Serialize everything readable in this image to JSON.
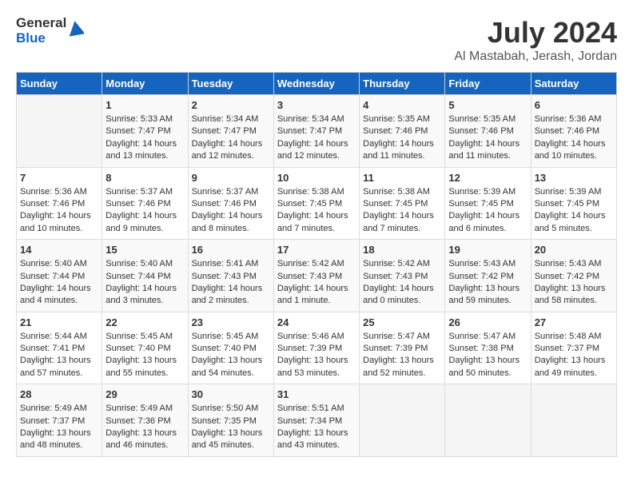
{
  "header": {
    "logo_general": "General",
    "logo_blue": "Blue",
    "month_title": "July 2024",
    "location": "Al Mastabah, Jerash, Jordan"
  },
  "columns": [
    "Sunday",
    "Monday",
    "Tuesday",
    "Wednesday",
    "Thursday",
    "Friday",
    "Saturday"
  ],
  "weeks": [
    [
      {
        "day": "",
        "info": ""
      },
      {
        "day": "1",
        "info": "Sunrise: 5:33 AM\nSunset: 7:47 PM\nDaylight: 14 hours\nand 13 minutes."
      },
      {
        "day": "2",
        "info": "Sunrise: 5:34 AM\nSunset: 7:47 PM\nDaylight: 14 hours\nand 12 minutes."
      },
      {
        "day": "3",
        "info": "Sunrise: 5:34 AM\nSunset: 7:47 PM\nDaylight: 14 hours\nand 12 minutes."
      },
      {
        "day": "4",
        "info": "Sunrise: 5:35 AM\nSunset: 7:46 PM\nDaylight: 14 hours\nand 11 minutes."
      },
      {
        "day": "5",
        "info": "Sunrise: 5:35 AM\nSunset: 7:46 PM\nDaylight: 14 hours\nand 11 minutes."
      },
      {
        "day": "6",
        "info": "Sunrise: 5:36 AM\nSunset: 7:46 PM\nDaylight: 14 hours\nand 10 minutes."
      }
    ],
    [
      {
        "day": "7",
        "info": "Sunrise: 5:36 AM\nSunset: 7:46 PM\nDaylight: 14 hours\nand 10 minutes."
      },
      {
        "day": "8",
        "info": "Sunrise: 5:37 AM\nSunset: 7:46 PM\nDaylight: 14 hours\nand 9 minutes."
      },
      {
        "day": "9",
        "info": "Sunrise: 5:37 AM\nSunset: 7:46 PM\nDaylight: 14 hours\nand 8 minutes."
      },
      {
        "day": "10",
        "info": "Sunrise: 5:38 AM\nSunset: 7:45 PM\nDaylight: 14 hours\nand 7 minutes."
      },
      {
        "day": "11",
        "info": "Sunrise: 5:38 AM\nSunset: 7:45 PM\nDaylight: 14 hours\nand 7 minutes."
      },
      {
        "day": "12",
        "info": "Sunrise: 5:39 AM\nSunset: 7:45 PM\nDaylight: 14 hours\nand 6 minutes."
      },
      {
        "day": "13",
        "info": "Sunrise: 5:39 AM\nSunset: 7:45 PM\nDaylight: 14 hours\nand 5 minutes."
      }
    ],
    [
      {
        "day": "14",
        "info": "Sunrise: 5:40 AM\nSunset: 7:44 PM\nDaylight: 14 hours\nand 4 minutes."
      },
      {
        "day": "15",
        "info": "Sunrise: 5:40 AM\nSunset: 7:44 PM\nDaylight: 14 hours\nand 3 minutes."
      },
      {
        "day": "16",
        "info": "Sunrise: 5:41 AM\nSunset: 7:43 PM\nDaylight: 14 hours\nand 2 minutes."
      },
      {
        "day": "17",
        "info": "Sunrise: 5:42 AM\nSunset: 7:43 PM\nDaylight: 14 hours\nand 1 minute."
      },
      {
        "day": "18",
        "info": "Sunrise: 5:42 AM\nSunset: 7:43 PM\nDaylight: 14 hours\nand 0 minutes."
      },
      {
        "day": "19",
        "info": "Sunrise: 5:43 AM\nSunset: 7:42 PM\nDaylight: 13 hours\nand 59 minutes."
      },
      {
        "day": "20",
        "info": "Sunrise: 5:43 AM\nSunset: 7:42 PM\nDaylight: 13 hours\nand 58 minutes."
      }
    ],
    [
      {
        "day": "21",
        "info": "Sunrise: 5:44 AM\nSunset: 7:41 PM\nDaylight: 13 hours\nand 57 minutes."
      },
      {
        "day": "22",
        "info": "Sunrise: 5:45 AM\nSunset: 7:40 PM\nDaylight: 13 hours\nand 55 minutes."
      },
      {
        "day": "23",
        "info": "Sunrise: 5:45 AM\nSunset: 7:40 PM\nDaylight: 13 hours\nand 54 minutes."
      },
      {
        "day": "24",
        "info": "Sunrise: 5:46 AM\nSunset: 7:39 PM\nDaylight: 13 hours\nand 53 minutes."
      },
      {
        "day": "25",
        "info": "Sunrise: 5:47 AM\nSunset: 7:39 PM\nDaylight: 13 hours\nand 52 minutes."
      },
      {
        "day": "26",
        "info": "Sunrise: 5:47 AM\nSunset: 7:38 PM\nDaylight: 13 hours\nand 50 minutes."
      },
      {
        "day": "27",
        "info": "Sunrise: 5:48 AM\nSunset: 7:37 PM\nDaylight: 13 hours\nand 49 minutes."
      }
    ],
    [
      {
        "day": "28",
        "info": "Sunrise: 5:49 AM\nSunset: 7:37 PM\nDaylight: 13 hours\nand 48 minutes."
      },
      {
        "day": "29",
        "info": "Sunrise: 5:49 AM\nSunset: 7:36 PM\nDaylight: 13 hours\nand 46 minutes."
      },
      {
        "day": "30",
        "info": "Sunrise: 5:50 AM\nSunset: 7:35 PM\nDaylight: 13 hours\nand 45 minutes."
      },
      {
        "day": "31",
        "info": "Sunrise: 5:51 AM\nSunset: 7:34 PM\nDaylight: 13 hours\nand 43 minutes."
      },
      {
        "day": "",
        "info": ""
      },
      {
        "day": "",
        "info": ""
      },
      {
        "day": "",
        "info": ""
      }
    ]
  ]
}
